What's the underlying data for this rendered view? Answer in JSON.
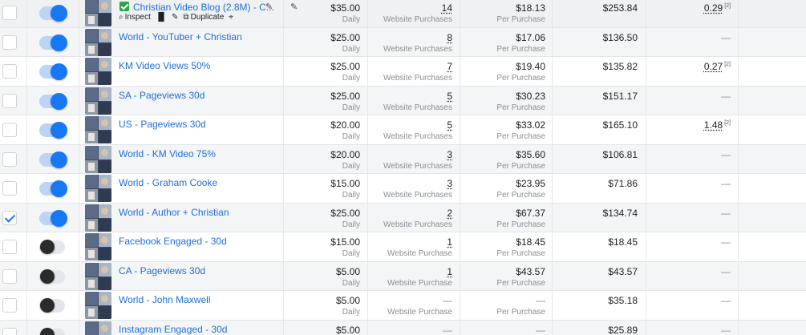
{
  "rows": [
    {
      "checked": false,
      "on": true,
      "name": "Christian Video Blog (2.8M) - C...",
      "first": true,
      "actions": {
        "inspect": "Inspect",
        "duplicate": "Duplicate"
      },
      "budget": "$35.00",
      "budget_type": "Daily",
      "results": "14",
      "results_label": "Website Purchases",
      "cost": "$18.13",
      "cost_label": "Per Purchase",
      "spent": "$253.84",
      "roas": "0.29",
      "roas_note": "[2]"
    },
    {
      "checked": false,
      "on": true,
      "name": "World - YouTuber + Christian",
      "budget": "$25.00",
      "budget_type": "Daily",
      "results": "8",
      "results_label": "Website Purchases",
      "cost": "$17.06",
      "cost_label": "Per Purchase",
      "spent": "$136.50",
      "roas": "—",
      "roas_note": ""
    },
    {
      "checked": false,
      "on": true,
      "name": "KM Video Views 50%",
      "budget": "$25.00",
      "budget_type": "Daily",
      "results": "7",
      "results_label": "Website Purchases",
      "cost": "$19.40",
      "cost_label": "Per Purchase",
      "spent": "$135.82",
      "roas": "0.27",
      "roas_note": "[2]"
    },
    {
      "checked": false,
      "on": true,
      "name": "SA - Pageviews 30d",
      "budget": "$25.00",
      "budget_type": "Daily",
      "results": "5",
      "results_label": "Website Purchases",
      "cost": "$30.23",
      "cost_label": "Per Purchase",
      "spent": "$151.17",
      "roas": "—",
      "roas_note": ""
    },
    {
      "checked": false,
      "on": true,
      "name": "US - Pageviews 30d",
      "budget": "$20.00",
      "budget_type": "Daily",
      "results": "5",
      "results_label": "Website Purchases",
      "cost": "$33.02",
      "cost_label": "Per Purchase",
      "spent": "$165.10",
      "roas": "1.48",
      "roas_note": "[2]"
    },
    {
      "checked": false,
      "on": true,
      "name": "World - KM Video 75%",
      "budget": "$20.00",
      "budget_type": "Daily",
      "results": "3",
      "results_label": "Website Purchases",
      "cost": "$35.60",
      "cost_label": "Per Purchase",
      "spent": "$106.81",
      "roas": "—",
      "roas_note": ""
    },
    {
      "checked": false,
      "on": true,
      "name": "World - Graham Cooke",
      "budget": "$15.00",
      "budget_type": "Daily",
      "results": "3",
      "results_label": "Website Purchases",
      "cost": "$23.95",
      "cost_label": "Per Purchase",
      "spent": "$71.86",
      "roas": "—",
      "roas_note": ""
    },
    {
      "checked": true,
      "on": true,
      "name": "World - Author + Christian",
      "budget": "$25.00",
      "budget_type": "Daily",
      "results": "2",
      "results_label": "Website Purchases",
      "cost": "$67.37",
      "cost_label": "Per Purchase",
      "spent": "$134.74",
      "roas": "—",
      "roas_note": ""
    },
    {
      "checked": false,
      "on": false,
      "name": "Facebook Engaged - 30d",
      "budget": "$15.00",
      "budget_type": "Daily",
      "results": "1",
      "results_label": "Website Purchase",
      "cost": "$18.45",
      "cost_label": "Per Purchase",
      "spent": "$18.45",
      "roas": "—",
      "roas_note": ""
    },
    {
      "checked": false,
      "on": false,
      "name": "CA - Pageviews 30d",
      "budget": "$5.00",
      "budget_type": "Daily",
      "results": "1",
      "results_label": "Website Purchase",
      "cost": "$43.57",
      "cost_label": "Per Purchase",
      "spent": "$43.57",
      "roas": "—",
      "roas_note": ""
    },
    {
      "checked": false,
      "on": false,
      "name": "World - John Maxwell",
      "budget": "$5.00",
      "budget_type": "Daily",
      "results": "—",
      "results_label": "Website Purchase",
      "cost": "—",
      "cost_label": "Per Purchase",
      "spent": "$35.18",
      "roas": "—",
      "roas_note": ""
    },
    {
      "checked": false,
      "on": false,
      "name": "Instagram Engaged - 30d",
      "budget": "$5.00",
      "budget_type": "Daily",
      "results": "—",
      "results_label": "",
      "cost": "—",
      "cost_label": "",
      "spent": "$25.89",
      "roas": "—",
      "roas_note": ""
    }
  ]
}
